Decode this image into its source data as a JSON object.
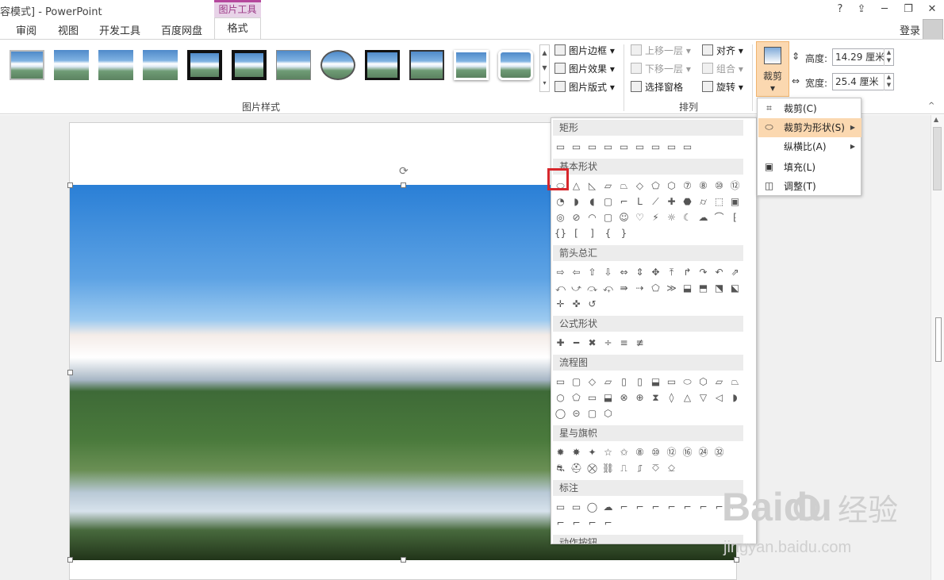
{
  "window": {
    "title": "容模式] - PowerPoint",
    "context_tab_group": "图片工具",
    "help": "?",
    "ribbon_display": "⇪",
    "minimize": "─",
    "restore": "❐",
    "close": "✕"
  },
  "tabs": [
    "审阅",
    "视图",
    "开发工具",
    "百度网盘",
    "格式"
  ],
  "login": "登录",
  "ribbon": {
    "picture_styles_label": "图片样式",
    "border": "图片边框",
    "effects": "图片效果",
    "layout": "图片版式",
    "arrange_label": "排列",
    "bring_forward": "上移一层",
    "send_backward": "下移一层",
    "selection_pane": "选择窗格",
    "align": "对齐",
    "group": "组合",
    "rotate": "旋转",
    "crop": "裁剪",
    "height_label": "高度:",
    "height_value": "14.29 厘米",
    "width_label": "宽度:",
    "width_value": "25.4 厘米"
  },
  "crop_menu": [
    {
      "label": "裁剪(C)",
      "icon": "crop-icon",
      "highlighted": false,
      "arrow": false
    },
    {
      "label": "裁剪为形状(S)",
      "icon": "shape-crop-icon",
      "highlighted": true,
      "arrow": true
    },
    {
      "label": "纵横比(A)",
      "icon": "",
      "highlighted": false,
      "arrow": true
    },
    {
      "label": "填充(L)",
      "icon": "fill-icon",
      "highlighted": false,
      "arrow": false
    },
    {
      "label": "调整(T)",
      "icon": "fit-icon",
      "highlighted": false,
      "arrow": false
    }
  ],
  "shape_gallery": {
    "categories": [
      "矩形",
      "基本形状",
      "箭头总汇",
      "公式形状",
      "流程图",
      "星与旗帜",
      "标注",
      "动作按钮"
    ],
    "selected_shape": "oval"
  },
  "watermark": {
    "brand": "Baidu",
    "cn": "经验",
    "url": "jingyan.baidu.com"
  }
}
